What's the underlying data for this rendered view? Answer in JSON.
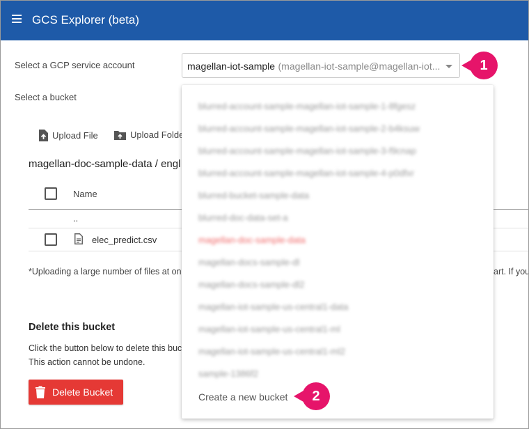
{
  "appbar": {
    "title": "GCS Explorer (beta)"
  },
  "account": {
    "label": "Select a GCP service account",
    "selected_name": "magellan-iot-sample",
    "selected_email": "(magellan-iot-sample@magellan-iot..."
  },
  "bucket": {
    "label": "Select a bucket"
  },
  "toolbar": {
    "upload_file": "Upload File",
    "upload_folder": "Upload Folder"
  },
  "breadcrumb": "magellan-doc-sample-data / engl",
  "table": {
    "name_header": "Name",
    "parent_dir": "..",
    "rows": [
      {
        "name": "elec_predict.csv"
      }
    ]
  },
  "notice": {
    "left": "*Uploading a large number of files at onc",
    "right": "art. If you"
  },
  "delete_section": {
    "title": "Delete this bucket",
    "desc1": "Click the button below to delete this buc",
    "desc2": "This action cannot be undone.",
    "button": "Delete Bucket"
  },
  "dropdown": {
    "items": [
      "blurred-account-sample-magellan-iot-sample-1-8fgesz",
      "blurred-account-sample-magellan-iot-sample-2-b4ksuw",
      "blurred-account-sample-magellan-iot-sample-3-f9cnap",
      "blurred-account-sample-magellan-iot-sample-4-p0dfxr",
      "blurred-bucket-sample-data",
      "blurred-doc-data-set-a",
      "magellan-doc-sample-data",
      "magellan-docs-sample-dl",
      "magellan-docs-sample-dl2",
      "magellan-iot-sample-us-central1-data",
      "magellan-iot-sample-us-central1-ml",
      "magellan-iot-sample-us-central1-ml2",
      "sample-1386f2"
    ],
    "create_label": "Create a new bucket"
  },
  "callouts": {
    "one": "1",
    "two": "2"
  },
  "colors": {
    "appbar": "#1e5aa8",
    "callout": "#e6146a",
    "delete_button": "#e53935"
  }
}
